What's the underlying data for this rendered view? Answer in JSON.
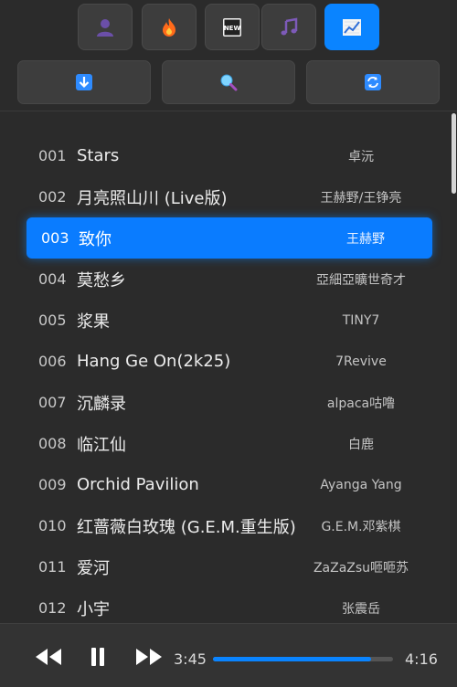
{
  "tabs": [
    {
      "icon": "user-icon",
      "active": false
    },
    {
      "icon": "fire-icon",
      "active": false
    },
    {
      "icon": "new-icon",
      "active": false
    },
    {
      "icon": "music-note-icon",
      "active": false
    },
    {
      "icon": "chart-icon",
      "active": true
    }
  ],
  "actions": [
    {
      "icon": "download-icon"
    },
    {
      "icon": "search-icon"
    },
    {
      "icon": "refresh-icon"
    }
  ],
  "songs": [
    {
      "num": "001",
      "title": "Stars",
      "artist": "卓沅"
    },
    {
      "num": "002",
      "title": "月亮照山川 (Live版)",
      "artist": "王赫野/王铮亮"
    },
    {
      "num": "003",
      "title": "致你",
      "artist": "王赫野",
      "active": true
    },
    {
      "num": "004",
      "title": "莫愁乡",
      "artist": "亞細亞曠世奇才"
    },
    {
      "num": "005",
      "title": "浆果",
      "artist": "TINY7"
    },
    {
      "num": "006",
      "title": "Hang Ge On(2k25)",
      "artist": "7Revive"
    },
    {
      "num": "007",
      "title": "沉麟录",
      "artist": "alpaca咕噜"
    },
    {
      "num": "008",
      "title": "临江仙",
      "artist": "白鹿"
    },
    {
      "num": "009",
      "title": "Orchid Pavilion",
      "artist": "Ayanga Yang"
    },
    {
      "num": "010",
      "title": "红蔷薇白玫瑰 (G.E.M.重生版)",
      "artist": "G.E.M.邓紫棋"
    },
    {
      "num": "011",
      "title": "爱河",
      "artist": "ZaZaZsu咂咂苏"
    },
    {
      "num": "012",
      "title": "小宇",
      "artist": "张震岳"
    }
  ],
  "player": {
    "current_time": "3:45",
    "total_time": "4:16",
    "progress": 0.879,
    "accent": "#0a84ff"
  }
}
